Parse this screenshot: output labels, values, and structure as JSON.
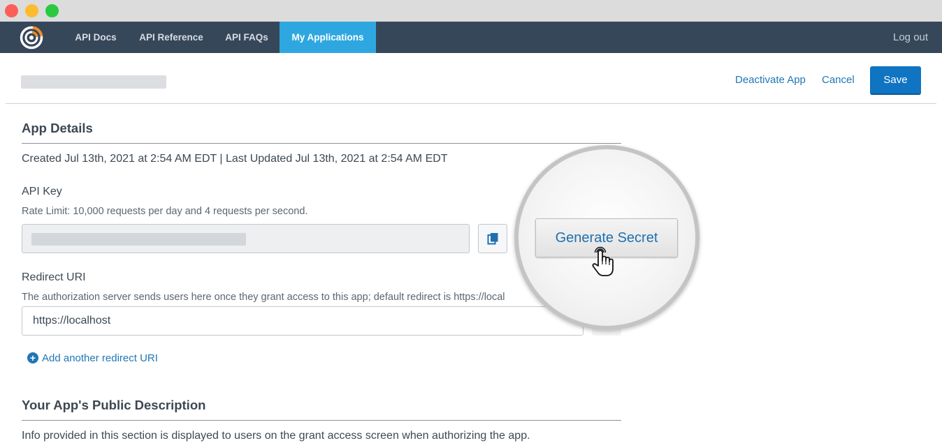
{
  "window": {
    "controls": [
      "close",
      "minimize",
      "maximize"
    ]
  },
  "navbar": {
    "logo_icon": "target-logo-icon",
    "items": [
      {
        "label": "API Docs"
      },
      {
        "label": "API Reference"
      },
      {
        "label": "API FAQs"
      },
      {
        "label": "My Applications",
        "active": true
      }
    ],
    "logout_label": "Log out"
  },
  "header": {
    "deactivate_label": "Deactivate App",
    "cancel_label": "Cancel",
    "save_label": "Save"
  },
  "app_details": {
    "title": "App Details",
    "timestamps": "Created Jul 13th, 2021 at 2:54 AM EDT | Last Updated Jul 13th, 2021 at 2:54 AM EDT",
    "api_key_label": "API Key",
    "rate_limit": "Rate Limit: 10,000 requests per day and 4 requests per second.",
    "generate_secret_label": "Generate Secret",
    "redirect_uri_label": "Redirect URI",
    "redirect_uri_help": "The authorization server sends users here once they grant access to this app; default redirect is https://local",
    "redirect_uri_value": "https://localhost",
    "add_redirect_label": "Add another redirect URI"
  },
  "public_description": {
    "title": "Your App's Public Description",
    "help": "Info provided in this section is displayed to users on the grant access screen when authorizing the app."
  },
  "colors": {
    "nav_bg": "#37475a",
    "nav_active": "#2ea7e0",
    "link": "#1f77b4",
    "primary_button": "#0f74c2"
  }
}
